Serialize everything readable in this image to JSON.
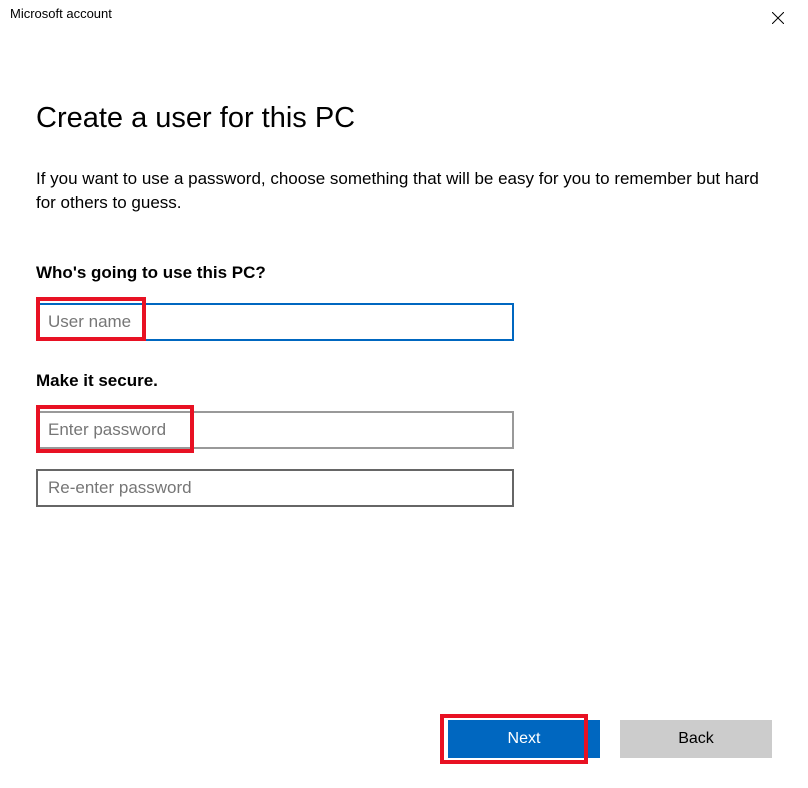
{
  "window": {
    "title": "Microsoft account"
  },
  "main": {
    "heading": "Create a user for this PC",
    "description": "If you want to use a password, choose something that will be easy for you to remember but hard for others to guess.",
    "section1": {
      "label": "Who's going to use this PC?",
      "username_placeholder": "User name"
    },
    "section2": {
      "label": "Make it secure.",
      "password_placeholder": "Enter password",
      "confirm_placeholder": "Re-enter password"
    }
  },
  "footer": {
    "next": "Next",
    "back": "Back"
  }
}
